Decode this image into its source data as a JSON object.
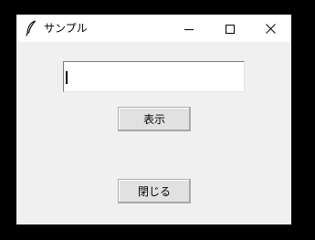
{
  "window": {
    "title": "サンプル",
    "icon": "feather-icon",
    "controls": {
      "minimize_icon": "minimize-icon",
      "maximize_icon": "maximize-icon",
      "close_icon": "close-icon"
    }
  },
  "form": {
    "entry_value": "",
    "show_button_label": "表示",
    "close_button_label": "閉じる"
  },
  "colors": {
    "window_background": "#f0f0f0",
    "titlebar_background": "#ffffff",
    "button_face": "#e1e1e1",
    "outer_background": "#000000"
  }
}
